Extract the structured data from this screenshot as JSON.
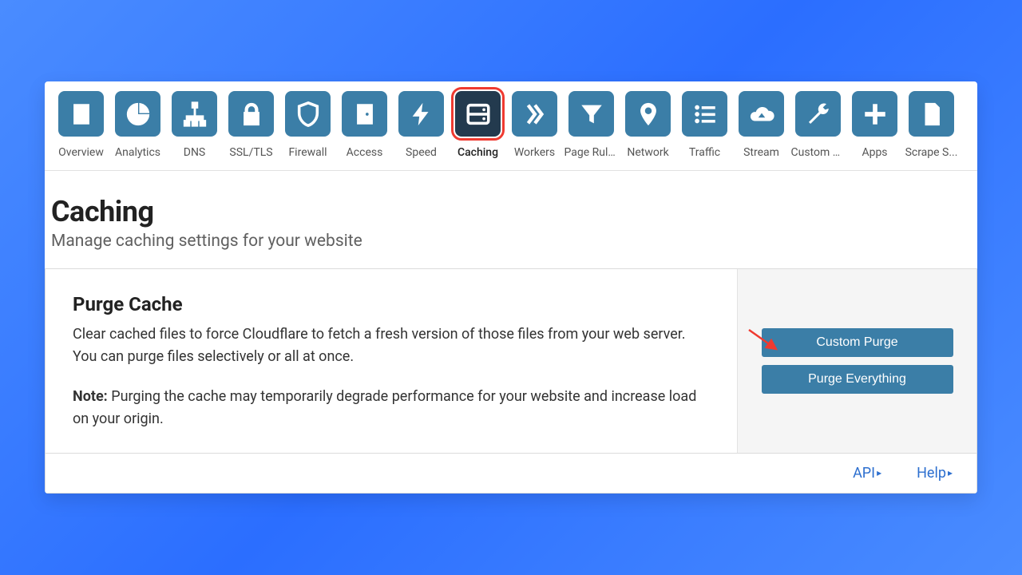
{
  "nav": [
    {
      "label": "Overview",
      "icon": "clipboard-icon"
    },
    {
      "label": "Analytics",
      "icon": "pie-icon"
    },
    {
      "label": "DNS",
      "icon": "sitemap-icon"
    },
    {
      "label": "SSL/TLS",
      "icon": "lock-icon"
    },
    {
      "label": "Firewall",
      "icon": "shield-icon"
    },
    {
      "label": "Access",
      "icon": "door-icon"
    },
    {
      "label": "Speed",
      "icon": "bolt-icon"
    },
    {
      "label": "Caching",
      "icon": "cache-icon",
      "active": true
    },
    {
      "label": "Workers",
      "icon": "workers-icon"
    },
    {
      "label": "Page Rules",
      "icon": "funnel-icon"
    },
    {
      "label": "Network",
      "icon": "pin-icon"
    },
    {
      "label": "Traffic",
      "icon": "list-icon"
    },
    {
      "label": "Stream",
      "icon": "cloud-icon"
    },
    {
      "label": "Custom P...",
      "icon": "wrench-icon"
    },
    {
      "label": "Apps",
      "icon": "plus-icon"
    },
    {
      "label": "Scrape S...",
      "icon": "doc-icon"
    }
  ],
  "header": {
    "title": "Caching",
    "subtitle": "Manage caching settings for your website"
  },
  "card": {
    "title": "Purge Cache",
    "desc": "Clear cached files to force Cloudflare to fetch a fresh version of those files from your web server. You can purge files selectively or all at once.",
    "note_label": "Note:",
    "note_text": " Purging the cache may temporarily degrade performance for your website and increase load on your origin.",
    "custom_purge": "Custom Purge",
    "purge_everything": "Purge Everything"
  },
  "footer": {
    "api": "API",
    "help": "Help"
  }
}
